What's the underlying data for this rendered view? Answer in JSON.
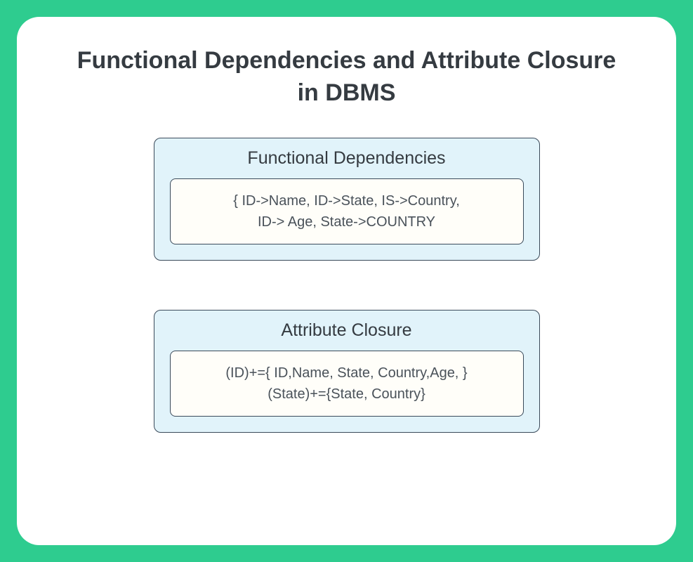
{
  "title": "Functional Dependencies and Attribute Closure in DBMS",
  "sections": {
    "functional_dependencies": {
      "heading": "Functional Dependencies",
      "content_line1": "{ ID->Name, ID->State, IS->Country,",
      "content_line2": "ID-> Age, State->COUNTRY"
    },
    "attribute_closure": {
      "heading": "Attribute Closure",
      "content_line1": "(ID)+={ ID,Name, State, Country,Age, }",
      "content_line2": "(State)+={State, Country}"
    }
  }
}
